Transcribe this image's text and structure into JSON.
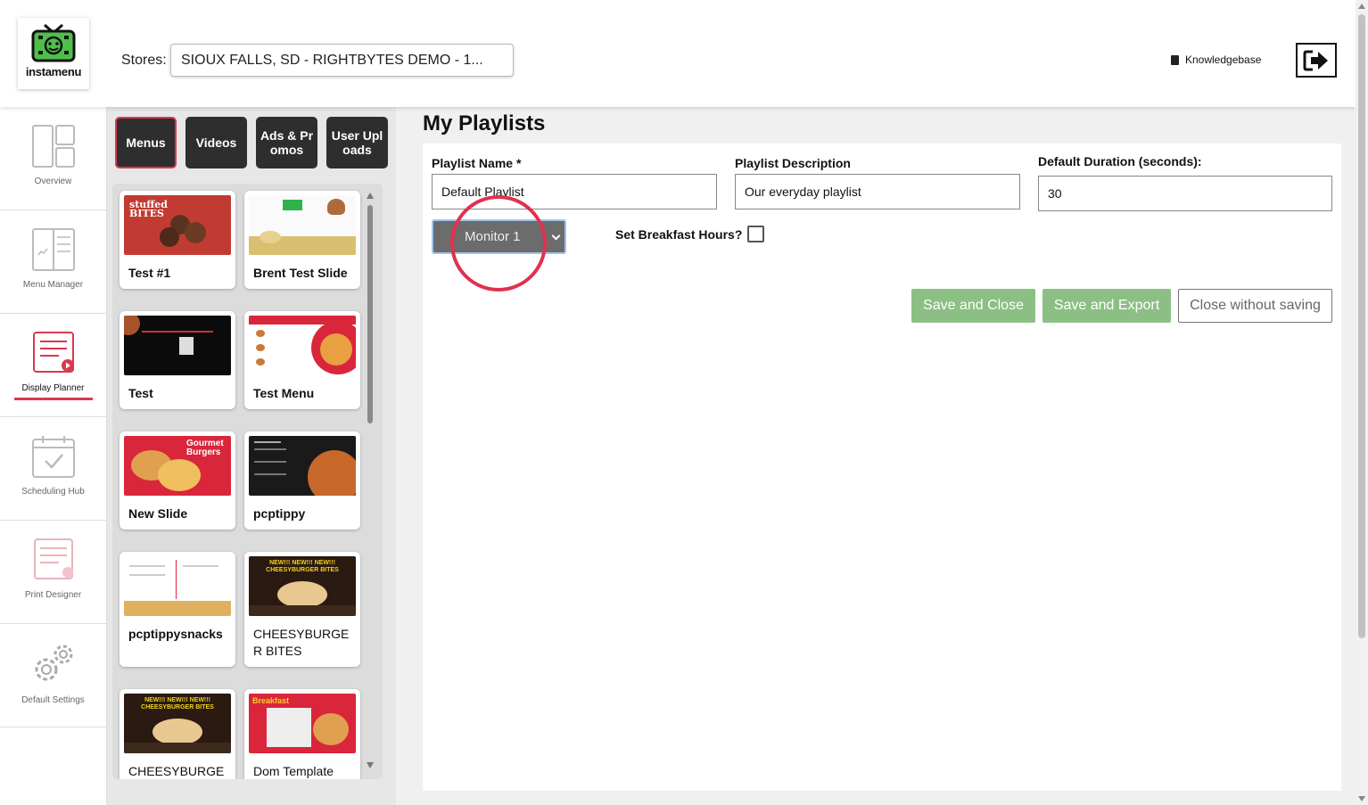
{
  "header": {
    "logo_text": "instamenu",
    "stores_label": "Stores:",
    "store_selected": "SIOUX FALLS, SD - RIGHTBYTES DEMO - 1...",
    "knowledgebase_label": "Knowledgebase",
    "logout_icon": "sign-out-icon"
  },
  "sidenav": {
    "items": [
      {
        "label": "Overview",
        "icon": "layout-icon"
      },
      {
        "label": "Menu Manager",
        "icon": "menu-board-icon"
      },
      {
        "label": "Display Planner",
        "icon": "playlist-icon",
        "active": true
      },
      {
        "label": "Scheduling Hub",
        "icon": "calendar-check-icon"
      },
      {
        "label": "Print Designer",
        "icon": "print-document-icon"
      },
      {
        "label": "Default Settings",
        "icon": "gears-icon"
      }
    ]
  },
  "library": {
    "tabs": [
      {
        "label": "Menus",
        "active": true
      },
      {
        "label": "Videos"
      },
      {
        "label": "Ads & Promos"
      },
      {
        "label": "User Uploads"
      }
    ],
    "cards": [
      {
        "title": "Test #1"
      },
      {
        "title": "Brent Test Slide"
      },
      {
        "title": "Test"
      },
      {
        "title": "Test Menu"
      },
      {
        "title": "New Slide"
      },
      {
        "title": "pcptippy"
      },
      {
        "title": "pcptippysnacks"
      },
      {
        "title": "CHEESYBURGER BITES"
      },
      {
        "title": "CHEESYBURGE"
      },
      {
        "title": "Dom Template"
      }
    ]
  },
  "main": {
    "title": "My Playlists",
    "playlist_name_label": "Playlist Name *",
    "playlist_name_value": "Default Playlist",
    "playlist_desc_label": "Playlist Description",
    "playlist_desc_value": "Our everyday playlist",
    "duration_label": "Default Duration (seconds):",
    "duration_value": "30",
    "monitor_selected": "Monitor 1",
    "breakfast_label": "Set Breakfast Hours?",
    "buttons": {
      "save_close": "Save and Close",
      "save_export": "Save and Export",
      "close_no_save": "Close without saving"
    }
  },
  "colors": {
    "accent_red": "#d9394d",
    "save_green": "#8cbf84",
    "tab_dark": "#2e2e2e",
    "highlight_ring": "#e0314f"
  }
}
